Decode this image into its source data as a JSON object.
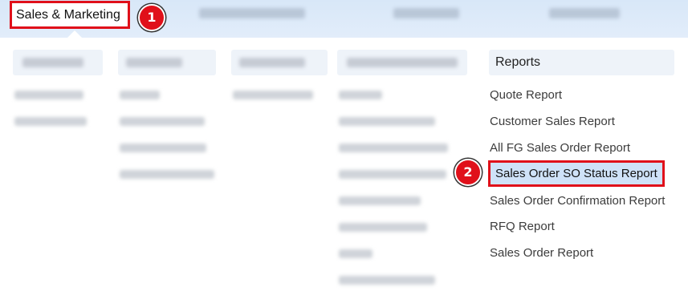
{
  "nav": {
    "active_label": "Sales & Marketing"
  },
  "badges": [
    "1",
    "2"
  ],
  "reports": {
    "header": "Reports",
    "items": [
      "Quote Report",
      "Customer Sales Report",
      "All FG Sales Order Report",
      "Sales Order SO Status Report",
      "Sales Order Confirmation Report",
      "RFQ Report",
      "Sales Order Report"
    ]
  },
  "colors": {
    "highlight_border": "#e0101a",
    "selected_bg": "#cfe2f8",
    "topbar": "#d8e7f8"
  }
}
